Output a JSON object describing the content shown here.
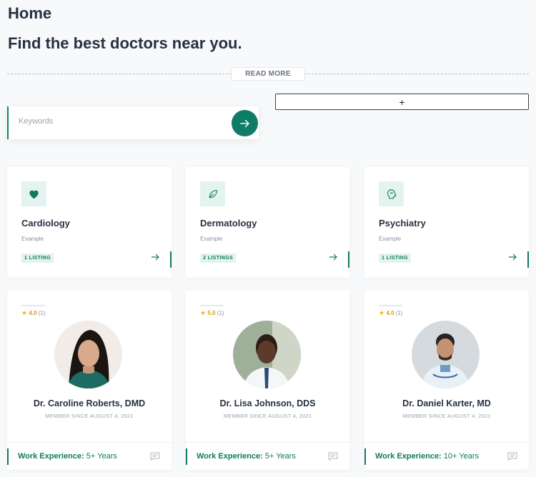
{
  "page": {
    "title": "Home",
    "hero_title": "Find the best doctors near you.",
    "read_more_label": "READ MORE",
    "plus_label": "+"
  },
  "search": {
    "placeholder": "Keywords",
    "submit_icon": "arrow-right-icon"
  },
  "colors": {
    "accent": "#107a61",
    "accent_light": "#e3f3ee",
    "star": "#f0b429"
  },
  "categories": [
    {
      "name": "Cardiology",
      "subtitle": "Example",
      "badge": "1 LISTING",
      "icon": "heart-icon"
    },
    {
      "name": "Dermatology",
      "subtitle": "Example",
      "badge": "2 LISTINGS",
      "icon": "leaf-icon"
    },
    {
      "name": "Psychiatry",
      "subtitle": "Example",
      "badge": "1 LISTING",
      "icon": "head-icon"
    }
  ],
  "doctors": [
    {
      "name": "Dr. Caroline Roberts, DMD",
      "rating": "4.0",
      "reviews": "(1)",
      "member_since": "MEMBER SINCE AUGUST 4, 2021",
      "experience_label": "Work Experience:",
      "experience_value": "5+ Years"
    },
    {
      "name": "Dr. Lisa Johnson, DDS",
      "rating": "5.0",
      "reviews": "(1)",
      "member_since": "MEMBER SINCE AUGUST 4, 2021",
      "experience_label": "Work Experience:",
      "experience_value": "5+ Years"
    },
    {
      "name": "Dr. Daniel Karter, MD",
      "rating": "4.0",
      "reviews": "(1)",
      "member_since": "MEMBER SINCE AUGUST 4, 2021",
      "experience_label": "Work Experience:",
      "experience_value": "10+ Years"
    }
  ]
}
